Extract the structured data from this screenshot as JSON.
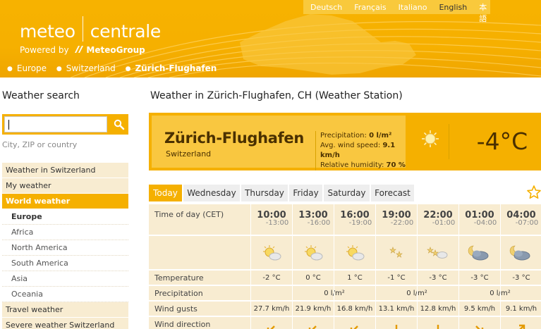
{
  "header": {
    "logo_left": "meteo",
    "logo_right": "centrale",
    "powered_prefix": "Powered by",
    "powered_brand": "MeteoGroup",
    "breadcrumb": [
      "Europe",
      "Switzerland",
      "Zürich-Flughafen"
    ],
    "languages": [
      "Deutsch",
      "Français",
      "Italiano",
      "English",
      "日本語"
    ],
    "active_language": "English"
  },
  "sidebar": {
    "title": "Weather search",
    "search_placeholder": "",
    "search_value": "",
    "hint": "City, ZIP or country",
    "menu": [
      {
        "label": "Weather in Switzerland",
        "kind": "top"
      },
      {
        "label": "My weather",
        "kind": "top"
      },
      {
        "label": "World weather",
        "kind": "active"
      },
      {
        "label": "Europe",
        "kind": "sub-selected"
      },
      {
        "label": "Africa",
        "kind": "sub"
      },
      {
        "label": "North America",
        "kind": "sub"
      },
      {
        "label": "South America",
        "kind": "sub"
      },
      {
        "label": "Asia",
        "kind": "sub"
      },
      {
        "label": "Oceania",
        "kind": "sub"
      },
      {
        "label": "Travel weather",
        "kind": "top"
      },
      {
        "label": "Severe weather Switzerland",
        "kind": "top"
      }
    ]
  },
  "main": {
    "title": "Weather in Zürich-Flughafen, CH (Weather Station)",
    "station": {
      "name": "Zürich-Flughafen",
      "country": "Switzerland",
      "precip_label": "Precipitation:",
      "precip_value": "0 l/m²",
      "wind_label": "Avg. wind speed:",
      "wind_value": "9.1 km/h",
      "humidity_label": "Relative humidity:",
      "humidity_value": "70 %",
      "temperature": "-4°C",
      "icon": "sun-icon"
    },
    "tabs": [
      "Today",
      "Wednesday",
      "Thursday",
      "Friday",
      "Saturday",
      "Forecast"
    ],
    "active_tab": "Today",
    "table": {
      "time_label": "Time of day (CET)",
      "temp_label": "Temperature",
      "precip_label": "Precipitation",
      "gusts_label": "Wind gusts",
      "direction_label": "Wind direction",
      "columns": [
        {
          "time": "10:00",
          "range": "-13:00",
          "icon": "sun-cloud-icon",
          "temp": "-2 °C",
          "gust": "27.7 km/h",
          "dir": "arrow-down-left-icon"
        },
        {
          "time": "13:00",
          "range": "-16:00",
          "icon": "sun-cloud-icon",
          "temp": "0 °C",
          "gust": "21.9 km/h",
          "dir": "arrow-down-left-icon"
        },
        {
          "time": "16:00",
          "range": "-19:00",
          "icon": "sun-cloud-icon",
          "temp": "1 °C",
          "gust": "16.8 km/h",
          "dir": "arrow-down-left-icon"
        },
        {
          "time": "19:00",
          "range": "-22:00",
          "icon": "stars-icon",
          "temp": "-1 °C",
          "gust": "13.1 km/h",
          "dir": "arrow-down-icon"
        },
        {
          "time": "22:00",
          "range": "-01:00",
          "icon": "stars-cloud-icon",
          "temp": "-3 °C",
          "gust": "12.8 km/h",
          "dir": "arrow-down-icon"
        },
        {
          "time": "01:00",
          "range": "-04:00",
          "icon": "moon-cloud-icon",
          "temp": "-3 °C",
          "gust": "9.5 km/h",
          "dir": "arrow-down-right-icon"
        },
        {
          "time": "04:00",
          "range": "-07:00",
          "icon": "moon-cloud-icon",
          "temp": "-3 °C",
          "gust": "9.1 km/h",
          "dir": "arrow-up-right-icon"
        }
      ],
      "precip_groups": [
        "0 l/m²",
        "0 l/m²",
        "0 l/m²"
      ]
    }
  },
  "colors": {
    "brand": "#f5b000",
    "brand_light": "#f9c740",
    "row_bg": "#f8ecd1",
    "dark_text": "#4a3000"
  }
}
